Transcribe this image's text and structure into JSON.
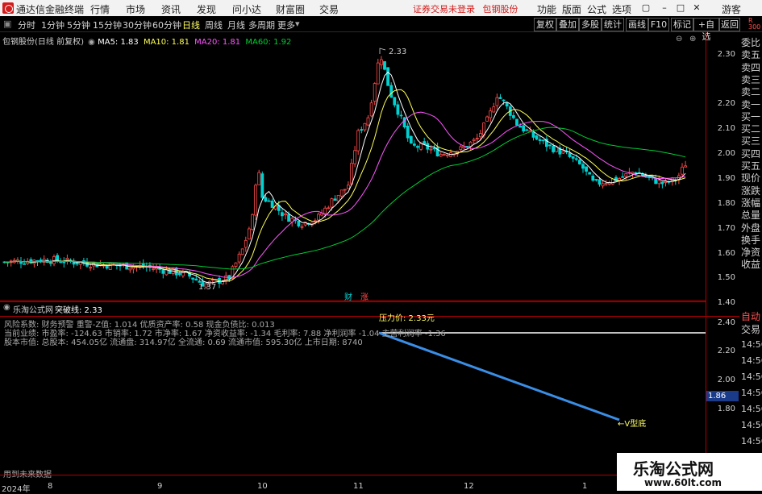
{
  "topbar": {
    "app_title": "通达信金融终端",
    "menu": [
      "行情",
      "市场",
      "资讯",
      "发现",
      "问小达",
      "财富圈",
      "交易"
    ],
    "center_left": "证券交易未登录",
    "center_right": "包钢股份",
    "right_menu": [
      "功能",
      "版面",
      "公式",
      "选项"
    ],
    "guest": "游客"
  },
  "periods": {
    "items": [
      "分时",
      "1分钟",
      "5分钟",
      "15分钟",
      "30分钟",
      "60分钟",
      "日线",
      "周线",
      "月线",
      "多周期",
      "更多"
    ],
    "active": "日线"
  },
  "toolbar": {
    "buttons": [
      "复权",
      "叠加",
      "多股",
      "统计",
      "画线",
      "F10",
      "标记",
      "+自选",
      "返回"
    ]
  },
  "chart": {
    "stock_title": "包钢股份(日线 前复权)",
    "ma5": "MA5: 1.83",
    "ma10": "MA10: 1.81",
    "ma20": "MA20: 1.81",
    "ma60": "MA60: 1.92",
    "high_label": "2.33",
    "low_label": "1.37",
    "cai_label": "财",
    "zhang_label": "涨",
    "price_ticks": [
      "2.30",
      "2.20",
      "2.10",
      "2.00",
      "1.90",
      "1.80",
      "1.70",
      "1.60",
      "1.50",
      "1.40"
    ],
    "colors": {
      "up": "#ff4a4a",
      "down": "#00d2d2",
      "ma5": "#ffffff",
      "ma10": "#ffff55",
      "ma20": "#ff55ff",
      "ma60": "#00cc33"
    }
  },
  "indicator": {
    "name": "乐淘公式网",
    "breakout": "突破线: 2.33",
    "pressure": "压力价: 2.33元",
    "vbottom": "←V型底",
    "rows": [
      "风险系数: 财务预警 重警-Z值: 1.014 优质资产率: 0.58 现金负债比: 0.013",
      "当前业绩: 市盈率: -124.63 市销率: 1.72 市净率: 1.67 净资收益率: -1.34 毛利率: 7.88 净利润率 -1.04 主营利润率 -1.36",
      "股本市值: 总股本: 454.05亿 流通盘: 314.97亿 全流通: 0.69 流通市值: 595.30亿 上市日期: 8740"
    ],
    "footer": "用到未来数据",
    "sub_ticks": [
      "2.40",
      "2.20",
      "2.00",
      "1.80"
    ],
    "current_value": "1.86"
  },
  "xaxis": {
    "labels": [
      "2024年",
      "8",
      "9",
      "10",
      "11",
      "12",
      "1"
    ]
  },
  "right_panel": {
    "top_badge": "R",
    "top_badge2": "300",
    "items": [
      "委比",
      "卖五",
      "卖四",
      "卖三",
      "卖二",
      "卖一",
      "买一",
      "买二",
      "买三",
      "买四",
      "买五",
      "现价",
      "涨跌",
      "涨幅",
      "总量",
      "外盘",
      "换手",
      "净资",
      "收益"
    ],
    "auto": "自动",
    "trade": "交易",
    "times": [
      "14:56",
      "14:56",
      "14:56",
      "14:56",
      "14:56",
      "14:56",
      "14:56",
      "14:56"
    ]
  },
  "watermark": {
    "title": "乐淘公式网",
    "url": "www.60lt.com"
  }
}
